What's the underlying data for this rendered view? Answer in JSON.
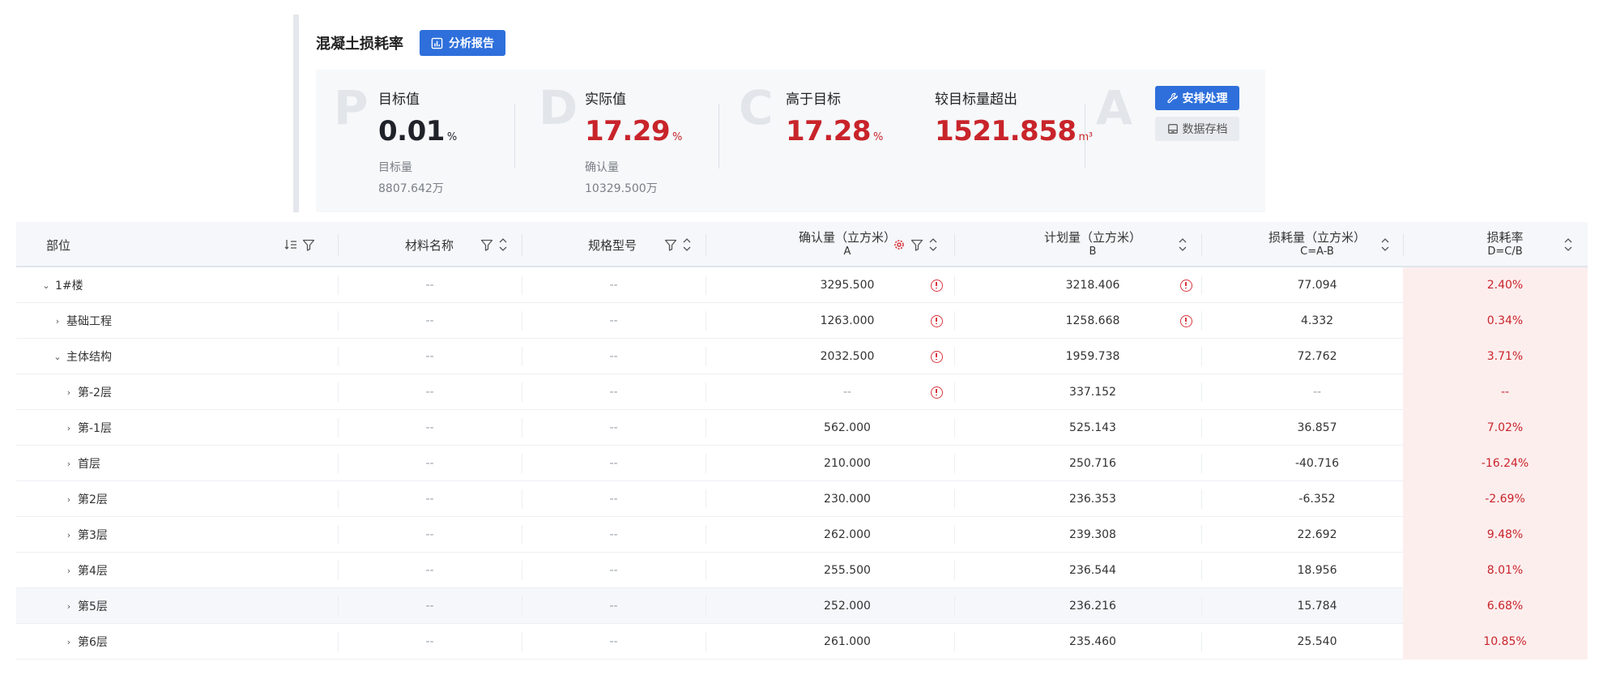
{
  "header": {
    "title": "混凝土损耗率",
    "report_button": "分析报告",
    "accent": "#2e6fdb"
  },
  "stats": {
    "target": {
      "letter": "P",
      "label": "目标值",
      "value": "0.01",
      "unit": "%",
      "sub_label": "目标量",
      "sub_value": "8807.642万"
    },
    "actual": {
      "letter": "D",
      "label": "实际值",
      "value": "17.29",
      "unit": "%",
      "sub_label": "确认量",
      "sub_value": "10329.500万"
    },
    "above": {
      "letter": "C",
      "label": "高于目标",
      "value": "17.28",
      "unit": "%"
    },
    "excess": {
      "label": "较目标量超出",
      "value": "1521.858",
      "unit": "m³"
    },
    "action": {
      "letter": "A",
      "arrange_button": "安排处理",
      "archive_button": "数据存档"
    },
    "alert_color": "#c8242a"
  },
  "table": {
    "columns": {
      "part": "部位",
      "material": "材料名称",
      "spec": "规格型号",
      "confirmed": "确认量（立方米）",
      "confirmed_sub": "A",
      "plan": "计划量（立方米）",
      "plan_sub": "B",
      "loss": "损耗量（立方米）",
      "loss_sub": "C=A-B",
      "rate": "损耗率",
      "rate_sub": "D=C/B"
    },
    "rows": [
      {
        "part": "1#楼",
        "level": 0,
        "expanded": true,
        "material": "--",
        "spec": "--",
        "confirmed": "3295.500",
        "confirmed_warn": true,
        "plan": "3218.406",
        "plan_warn": true,
        "loss": "77.094",
        "rate": "2.40%"
      },
      {
        "part": "基础工程",
        "level": 1,
        "expanded": false,
        "material": "--",
        "spec": "--",
        "confirmed": "1263.000",
        "confirmed_warn": true,
        "plan": "1258.668",
        "plan_warn": true,
        "loss": "4.332",
        "rate": "0.34%"
      },
      {
        "part": "主体结构",
        "level": 1,
        "expanded": true,
        "material": "--",
        "spec": "--",
        "confirmed": "2032.500",
        "confirmed_warn": true,
        "plan": "1959.738",
        "plan_warn": false,
        "loss": "72.762",
        "rate": "3.71%"
      },
      {
        "part": "第-2层",
        "level": 2,
        "expanded": false,
        "material": "--",
        "spec": "--",
        "confirmed": "--",
        "confirmed_warn": true,
        "plan": "337.152",
        "plan_warn": false,
        "loss": "--",
        "rate": "--"
      },
      {
        "part": "第-1层",
        "level": 2,
        "expanded": false,
        "material": "--",
        "spec": "--",
        "confirmed": "562.000",
        "confirmed_warn": false,
        "plan": "525.143",
        "plan_warn": false,
        "loss": "36.857",
        "rate": "7.02%"
      },
      {
        "part": "首层",
        "level": 2,
        "expanded": false,
        "material": "--",
        "spec": "--",
        "confirmed": "210.000",
        "confirmed_warn": false,
        "plan": "250.716",
        "plan_warn": false,
        "loss": "-40.716",
        "rate": "-16.24%"
      },
      {
        "part": "第2层",
        "level": 2,
        "expanded": false,
        "material": "--",
        "spec": "--",
        "confirmed": "230.000",
        "confirmed_warn": false,
        "plan": "236.353",
        "plan_warn": false,
        "loss": "-6.352",
        "rate": "-2.69%"
      },
      {
        "part": "第3层",
        "level": 2,
        "expanded": false,
        "material": "--",
        "spec": "--",
        "confirmed": "262.000",
        "confirmed_warn": false,
        "plan": "239.308",
        "plan_warn": false,
        "loss": "22.692",
        "rate": "9.48%"
      },
      {
        "part": "第4层",
        "level": 2,
        "expanded": false,
        "material": "--",
        "spec": "--",
        "confirmed": "255.500",
        "confirmed_warn": false,
        "plan": "236.544",
        "plan_warn": false,
        "loss": "18.956",
        "rate": "8.01%"
      },
      {
        "part": "第5层",
        "level": 2,
        "expanded": false,
        "material": "--",
        "spec": "--",
        "confirmed": "252.000",
        "confirmed_warn": false,
        "plan": "236.216",
        "plan_warn": false,
        "loss": "15.784",
        "rate": "6.68%",
        "highlighted": true
      },
      {
        "part": "第6层",
        "level": 2,
        "expanded": false,
        "material": "--",
        "spec": "--",
        "confirmed": "261.000",
        "confirmed_warn": false,
        "plan": "235.460",
        "plan_warn": false,
        "loss": "25.540",
        "rate": "10.85%"
      }
    ]
  }
}
